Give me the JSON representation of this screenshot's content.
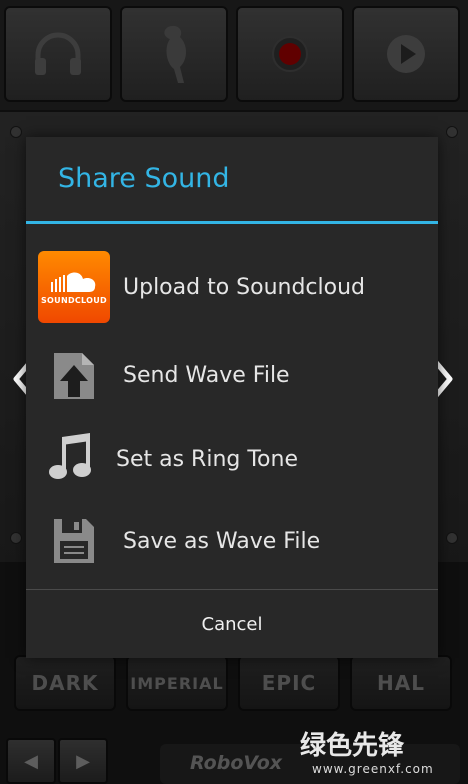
{
  "dialog": {
    "title": "Share Sound",
    "options": [
      {
        "label": "Upload to Soundcloud",
        "icon": "soundcloud-logo",
        "logo_text": "SOUNDCLOUD"
      },
      {
        "label": "Send Wave File",
        "icon": "upload-file-icon"
      },
      {
        "label": "Set as Ring Tone",
        "icon": "music-note-icon"
      },
      {
        "label": "Save as Wave File",
        "icon": "floppy-disk-icon"
      }
    ],
    "cancel_label": "Cancel"
  },
  "background": {
    "toolbar_icons": [
      "headphones-icon",
      "parrot-icon",
      "record-icon",
      "play-icon"
    ],
    "presets": [
      "DARK",
      "IMPERIAL",
      "EPIC",
      "HAL"
    ],
    "app_name": "RoboVox",
    "watermark": "绿色先锋",
    "watermark_url": "www.greenxf.com"
  },
  "colors": {
    "accent": "#33b5e5",
    "soundcloud": "#f25a00",
    "record": "#b00000"
  }
}
